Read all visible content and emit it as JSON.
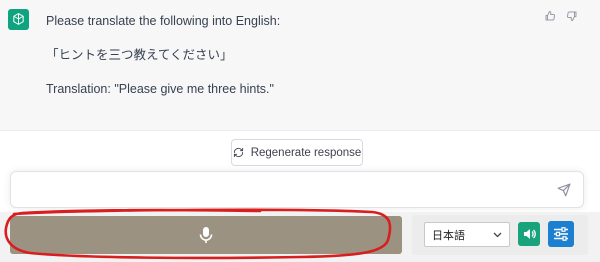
{
  "message": {
    "lines": [
      "Please translate the following into English:",
      "「ヒントを三つ教えてください」",
      "Translation: \"Please give me three hints.\""
    ]
  },
  "regenerate": {
    "label": "Regenerate response"
  },
  "chat_input": {
    "value": "",
    "placeholder": ""
  },
  "voice": {
    "language": "日本語"
  },
  "colors": {
    "avatar": "#10a37f",
    "mic_bar": "#9c9282",
    "speaker_button": "#19a37c",
    "settings_button": "#1d7fd0",
    "annotation": "#d81e1e"
  }
}
